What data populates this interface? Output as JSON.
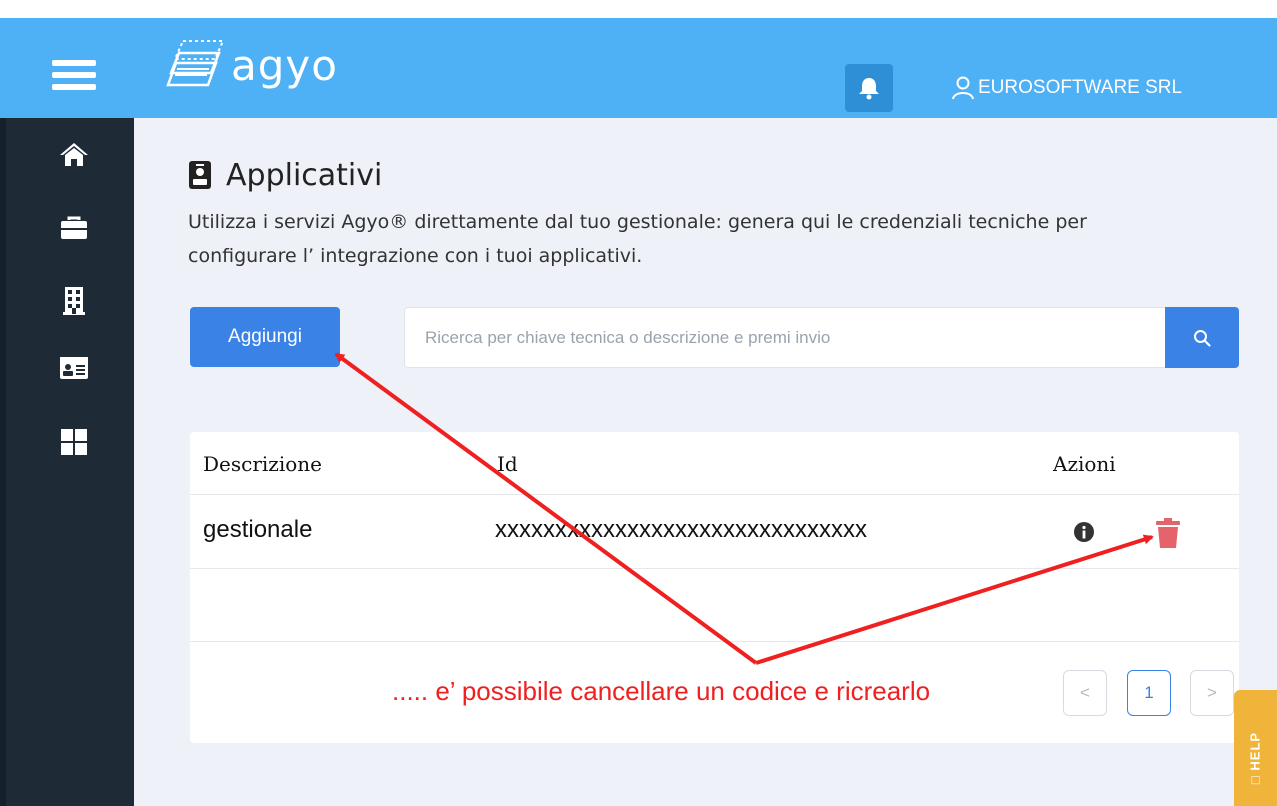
{
  "header": {
    "logo_text": "agyo",
    "user_name": "EUROSOFTWARE SRL"
  },
  "sidebar": {
    "items": [
      {
        "icon": "home-icon"
      },
      {
        "icon": "briefcase-icon"
      },
      {
        "icon": "building-icon"
      },
      {
        "icon": "id-card-icon"
      },
      {
        "icon": "grid-icon"
      }
    ]
  },
  "page": {
    "title": "Applicativi",
    "subtitle_line1": "Utilizza i servizi Agyo® direttamente dal tuo gestionale: genera qui le credenziali tecniche per",
    "subtitle_line2": "configurare l’ integrazione con i tuoi applicativi."
  },
  "toolbar": {
    "add_label": "Aggiungi",
    "search_placeholder": "Ricerca per chiave tecnica o descrizione e premi invio",
    "search_value": ""
  },
  "table": {
    "columns": [
      "Descrizione",
      "Id",
      "Azioni"
    ],
    "rows": [
      {
        "descrizione": "gestionale",
        "id": "xxxxxxxxxxxxxxxxxxxxxxxxxxxxxxx"
      }
    ]
  },
  "pagination": {
    "prev": "<",
    "current": "1",
    "next": ">"
  },
  "annotation": {
    "text": "..... e’ possibile cancellare un codice e ricrearlo"
  },
  "help": {
    "label": "□ HELP"
  },
  "colors": {
    "header": "#4eb0f5",
    "sidebar": "#1e2b36",
    "primary": "#3b82e6",
    "danger": "#e5636a",
    "annotation": "#ef2020",
    "help": "#f0b43a"
  }
}
